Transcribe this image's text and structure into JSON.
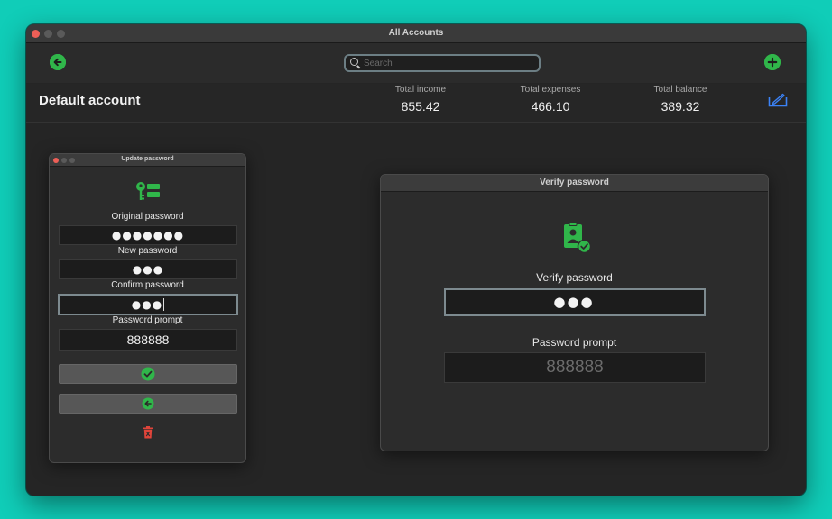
{
  "window": {
    "title": "All Accounts"
  },
  "toolbar": {
    "search_placeholder": "Search",
    "back_icon": "arrow-left-circle-icon",
    "add_icon": "plus-circle-icon"
  },
  "summary": {
    "account_name": "Default account",
    "income_label": "Total income",
    "income_value": "855.42",
    "expenses_label": "Total expenses",
    "expenses_value": "466.10",
    "balance_label": "Total balance",
    "balance_value": "389.32"
  },
  "update_sheet": {
    "title": "Update password",
    "original_label": "Original password",
    "original_value": "●●●●●●●",
    "new_label": "New password",
    "new_value": "●●●",
    "confirm_label": "Confirm password",
    "confirm_value": "●●●",
    "prompt_label": "Password prompt",
    "prompt_value": "888888"
  },
  "verify_sheet": {
    "title": "Verify password",
    "verify_label": "Verify password",
    "verify_value": "●●●",
    "prompt_label": "Password prompt",
    "prompt_placeholder": "888888"
  },
  "colors": {
    "background": "#10cdb8",
    "accent_green": "#30b64a",
    "edit_blue": "#3b82f6",
    "delete_red": "#e0443a"
  }
}
